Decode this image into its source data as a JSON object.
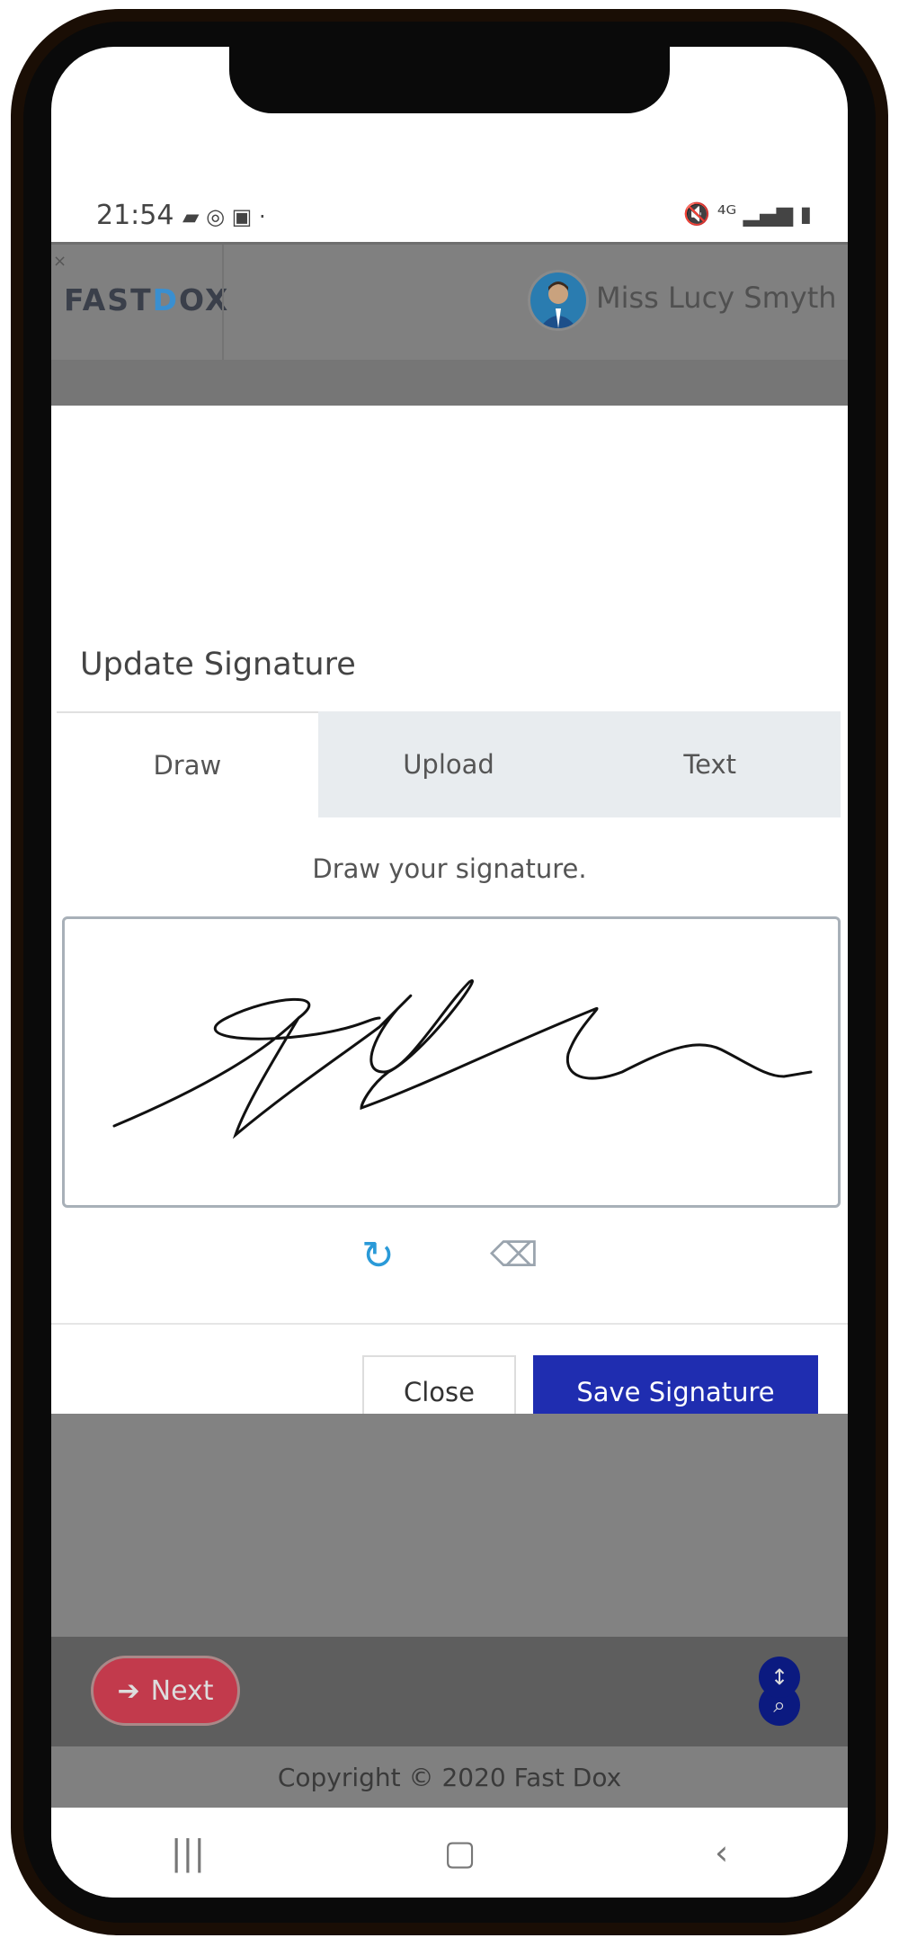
{
  "status_bar": {
    "time": "21:54",
    "left_icons": [
      "message-icon",
      "whatsapp-icon",
      "app-icon"
    ],
    "right_icons": [
      "mute-icon",
      "4g-icon",
      "signal-icon",
      "battery-icon"
    ]
  },
  "header": {
    "logo_prefix": "FAST",
    "logo_d": "D",
    "logo_suffix": "OX",
    "close_glyph": "×",
    "user_name": "Miss Lucy Smyth"
  },
  "modal": {
    "title": "Update Signature",
    "tabs": [
      {
        "label": "Draw",
        "active": true
      },
      {
        "label": "Upload",
        "active": false
      },
      {
        "label": "Text",
        "active": false
      }
    ],
    "hint": "Draw your signature.",
    "close_label": "Close",
    "save_label": "Save Signature"
  },
  "bottom": {
    "next_label": "Next",
    "copyright": "Copyright © 2020 Fast Dox"
  },
  "nav": {
    "recent": "|||",
    "home": "▢",
    "back": "‹"
  },
  "colors": {
    "accent": "#1f2db0",
    "next": "#c23a4c",
    "refresh": "#2a9ad8"
  }
}
